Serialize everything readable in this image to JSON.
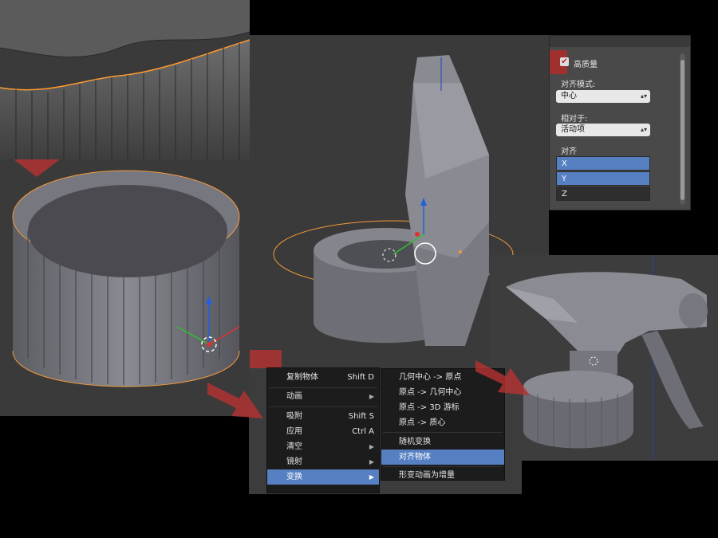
{
  "align_panel": {
    "checkbox_label": "高质量",
    "align_mode_label": "对齐模式:",
    "align_mode_value": "中心",
    "relative_to_label": "相对于:",
    "relative_to_value": "活动项",
    "align_label": "对齐",
    "axes": [
      "X",
      "Y",
      "Z"
    ]
  },
  "context_menu": {
    "items": [
      {
        "label": "复制物体",
        "shortcut": "Shift D"
      },
      {
        "label": "动画",
        "shortcut": ""
      },
      {
        "label": "吸附",
        "shortcut": "Shift S"
      },
      {
        "label": "应用",
        "shortcut": "Ctrl A"
      },
      {
        "label": "清空",
        "shortcut": ""
      },
      {
        "label": "镜射",
        "shortcut": ""
      },
      {
        "label": "变换",
        "shortcut": ""
      }
    ]
  },
  "transform_submenu": {
    "items": [
      "几何中心 -> 原点",
      "原点 -> 几何中心",
      "原点 -> 3D 游标",
      "原点 -> 质心",
      "随机变换",
      "对齐物体",
      "形变动画为增量"
    ]
  },
  "colors": {
    "viewport_bg": "#3a3a3a",
    "menu_bg": "#1c1c1c",
    "highlight": "#5680c2",
    "selection_outline": "#f29a3a",
    "annotation_arrow": "#b83232"
  }
}
